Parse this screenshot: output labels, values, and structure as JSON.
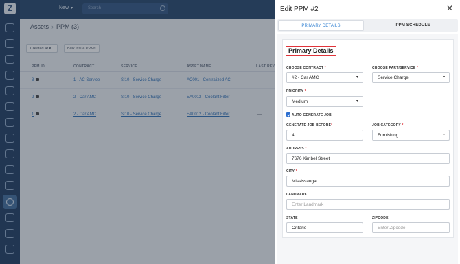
{
  "topbar": {
    "new_label": "New",
    "search_placeholder": "Search"
  },
  "breadcrumb": {
    "root": "Assets",
    "current": "PPM (3)"
  },
  "toolbar": {
    "filter_label": "Created At",
    "bulk_label": "Bulk Issue PPMs"
  },
  "table": {
    "headers": [
      "PPM ID",
      "CONTRACT",
      "SERVICE",
      "ASSET NAME",
      "LAST REV"
    ],
    "rows": [
      {
        "id": "3",
        "contract": "1 - AC Service",
        "service": "SI10 - Service Charge",
        "asset": "AC001 - Centralized AC",
        "last": "---"
      },
      {
        "id": "2",
        "contract": "2 - Car AMC",
        "service": "SI10 - Service Charge",
        "asset": "EA0012 - Coolant Filter",
        "last": "---"
      },
      {
        "id": "1",
        "contract": "2 - Car AMC",
        "service": "SI10 - Service Charge",
        "asset": "EA0012 - Coolant Filter",
        "last": "---"
      }
    ]
  },
  "drawer": {
    "title": "Edit PPM #2",
    "tabs": {
      "primary": "PRIMARY DETAILS",
      "schedule": "PPM SCHEDULE"
    },
    "section_title": "Primary Details",
    "contract": {
      "label": "CHOOSE CONTRACT",
      "value": "#2 - Car AMC"
    },
    "part_service": {
      "label": "CHOOSE PART/SERVICE",
      "value": "Service Charge"
    },
    "priority": {
      "label": "PRIORITY",
      "value": "Medium"
    },
    "auto_generate": {
      "label": "AUTO GENERATE JOB",
      "checked": true
    },
    "generate_before": {
      "label": "GENERATE JOB BEFORE",
      "value": "4"
    },
    "job_category": {
      "label": "JOB CATEGORY",
      "value": "Furnishing"
    },
    "address": {
      "label": "ADDRESS",
      "value": "7676 Kimbel Street"
    },
    "city": {
      "label": "CITY",
      "value": "Mississauga"
    },
    "landmark": {
      "label": "LANDMARK",
      "placeholder": "Enter Landmark"
    },
    "state": {
      "label": "STATE",
      "value": "Ontario"
    },
    "zipcode": {
      "label": "ZIPCODE",
      "placeholder": "Enter Zipcode"
    }
  }
}
